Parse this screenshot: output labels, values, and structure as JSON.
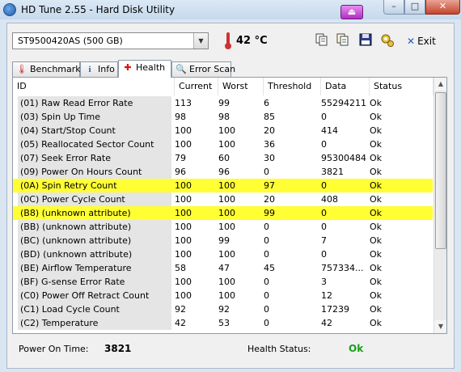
{
  "window": {
    "title": "HD Tune 2.55 - Hard Disk Utility",
    "ext_icon": "eject-icon",
    "min_label": "–",
    "max_label": "□",
    "close_label": "✕"
  },
  "toolbar": {
    "drive": "ST9500420AS (500 GB)",
    "temperature": "42 °C",
    "exit_label": "Exit",
    "icons": [
      "copy-icon",
      "copy-all-icon",
      "save-icon",
      "options-icon"
    ]
  },
  "tabs": [
    {
      "label": "Benchmark",
      "icon": "thermometer-icon"
    },
    {
      "label": "Info",
      "icon": "info-icon"
    },
    {
      "label": "Health",
      "icon": "health-cross-icon",
      "active": true
    },
    {
      "label": "Error Scan",
      "icon": "magnifier-icon"
    }
  ],
  "table": {
    "headers": [
      "ID",
      "Current",
      "Worst",
      "Threshold",
      "Data",
      "Status"
    ],
    "rows": [
      {
        "id": "(01) Raw Read Error Rate",
        "current": "113",
        "worst": "99",
        "threshold": "6",
        "data": "55294211",
        "status": "Ok",
        "hl": false
      },
      {
        "id": "(03) Spin Up Time",
        "current": "98",
        "worst": "98",
        "threshold": "85",
        "data": "0",
        "status": "Ok",
        "hl": false
      },
      {
        "id": "(04) Start/Stop Count",
        "current": "100",
        "worst": "100",
        "threshold": "20",
        "data": "414",
        "status": "Ok",
        "hl": false
      },
      {
        "id": "(05) Reallocated Sector Count",
        "current": "100",
        "worst": "100",
        "threshold": "36",
        "data": "0",
        "status": "Ok",
        "hl": false
      },
      {
        "id": "(07) Seek Error Rate",
        "current": "79",
        "worst": "60",
        "threshold": "30",
        "data": "95300484",
        "status": "Ok",
        "hl": false
      },
      {
        "id": "(09) Power On Hours Count",
        "current": "96",
        "worst": "96",
        "threshold": "0",
        "data": "3821",
        "status": "Ok",
        "hl": false
      },
      {
        "id": "(0A) Spin Retry Count",
        "current": "100",
        "worst": "100",
        "threshold": "97",
        "data": "0",
        "status": "Ok",
        "hl": true
      },
      {
        "id": "(0C) Power Cycle Count",
        "current": "100",
        "worst": "100",
        "threshold": "20",
        "data": "408",
        "status": "Ok",
        "hl": false
      },
      {
        "id": "(B8) (unknown attribute)",
        "current": "100",
        "worst": "100",
        "threshold": "99",
        "data": "0",
        "status": "Ok",
        "hl": true
      },
      {
        "id": "(BB) (unknown attribute)",
        "current": "100",
        "worst": "100",
        "threshold": "0",
        "data": "0",
        "status": "Ok",
        "hl": false
      },
      {
        "id": "(BC) (unknown attribute)",
        "current": "100",
        "worst": "99",
        "threshold": "0",
        "data": "7",
        "status": "Ok",
        "hl": false
      },
      {
        "id": "(BD) (unknown attribute)",
        "current": "100",
        "worst": "100",
        "threshold": "0",
        "data": "0",
        "status": "Ok",
        "hl": false
      },
      {
        "id": "(BE) Airflow Temperature",
        "current": "58",
        "worst": "47",
        "threshold": "45",
        "data": "757334...",
        "status": "Ok",
        "hl": false
      },
      {
        "id": "(BF) G-sense Error Rate",
        "current": "100",
        "worst": "100",
        "threshold": "0",
        "data": "3",
        "status": "Ok",
        "hl": false
      },
      {
        "id": "(C0) Power Off Retract Count",
        "current": "100",
        "worst": "100",
        "threshold": "0",
        "data": "12",
        "status": "Ok",
        "hl": false
      },
      {
        "id": "(C1) Load Cycle Count",
        "current": "92",
        "worst": "92",
        "threshold": "0",
        "data": "17239",
        "status": "Ok",
        "hl": false
      },
      {
        "id": "(C2) Temperature",
        "current": "42",
        "worst": "53",
        "threshold": "0",
        "data": "42",
        "status": "Ok",
        "hl": false
      }
    ]
  },
  "footer": {
    "power_on_label": "Power On Time:",
    "power_on_value": "3821",
    "health_label": "Health Status:",
    "health_value": "Ok"
  },
  "colors": {
    "highlight": "#ffff33",
    "health_ok": "#1a9e1a"
  }
}
